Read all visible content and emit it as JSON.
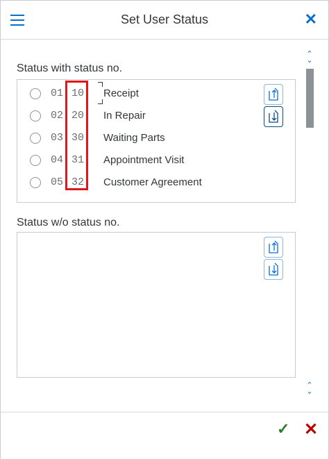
{
  "header": {
    "title": "Set User Status",
    "menu_icon": "hamburger-icon",
    "close_icon": "close-icon",
    "close_glyph": "✕"
  },
  "sections": {
    "with_no": {
      "label": "Status with status no.",
      "items": [
        {
          "pos": "01",
          "status_no": "10",
          "label": "Receipt",
          "selected": false
        },
        {
          "pos": "02",
          "status_no": "20",
          "label": "In Repair",
          "selected": false
        },
        {
          "pos": "03",
          "status_no": "30",
          "label": "Waiting Parts",
          "selected": false
        },
        {
          "pos": "04",
          "status_no": "31",
          "label": "Appointment Visit",
          "selected": false
        },
        {
          "pos": "05",
          "status_no": "32",
          "label": "Customer Agreement",
          "selected": false
        }
      ]
    },
    "without_no": {
      "label": "Status w/o status no.",
      "items": []
    }
  },
  "footer": {
    "ok_glyph": "✓",
    "cancel_glyph": "✕"
  },
  "colors": {
    "accent": "#0a6ed1",
    "highlight": "#e0161d",
    "ok": "#2b7d2b",
    "cancel": "#bb0000"
  }
}
